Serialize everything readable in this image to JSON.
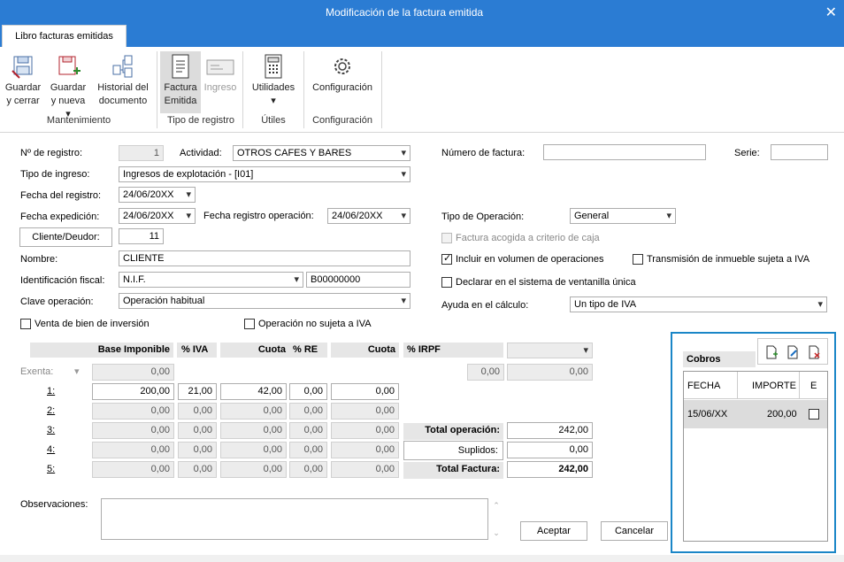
{
  "window": {
    "title": "Modificación de la factura emitida",
    "close": "✕"
  },
  "tab": {
    "label": "Libro facturas emitidas"
  },
  "ribbon": {
    "guardar_cerrar": [
      "Guardar",
      "y cerrar"
    ],
    "guardar_nueva": [
      "Guardar",
      "y nueva ▾"
    ],
    "historial": [
      "Historial del",
      "documento"
    ],
    "factura_emitida": [
      "Factura",
      "Emitida"
    ],
    "ingreso": "Ingreso",
    "utilidades": "Utilidades",
    "configuracion": "Configuración",
    "groups": {
      "mantenimiento": "Mantenimiento",
      "tipo": "Tipo de registro",
      "utiles": "Útiles",
      "config": "Configuración"
    }
  },
  "form": {
    "n_registro": {
      "label": "Nº de registro:",
      "value": "1"
    },
    "actividad": {
      "label": "Actividad:",
      "value": "OTROS CAFES Y BARES"
    },
    "numero_factura": {
      "label": "Número de factura:",
      "value": ""
    },
    "serie": {
      "label": "Serie:",
      "value": ""
    },
    "tipo_ingreso": {
      "label": "Tipo de ingreso:",
      "value": "Ingresos de explotación - [I01]"
    },
    "fecha_registro": {
      "label": "Fecha del registro:",
      "value": "24/06/20XX"
    },
    "fecha_expedicion": {
      "label": "Fecha expedición:",
      "value": "24/06/20XX"
    },
    "fecha_reg_op": {
      "label": "Fecha registro operación:",
      "value": "24/06/20XX"
    },
    "tipo_operacion": {
      "label": "Tipo de Operación:",
      "value": "General"
    },
    "cliente_btn": "Cliente/Deudor:",
    "cliente_val": "11",
    "factura_caja": "Factura acogida a criterio de caja",
    "nombre": {
      "label": "Nombre:",
      "value": "CLIENTE"
    },
    "incluir_vol": "Incluir en  volumen de operaciones",
    "transmision": "Transmisión de inmueble sujeta a IVA",
    "ident_fiscal": {
      "label": "Identificación fiscal:",
      "type": "N.I.F.",
      "value": "B00000000"
    },
    "declarar": "Declarar en el sistema de ventanilla única",
    "clave_op": {
      "label": "Clave operación:",
      "value": "Operación habitual"
    },
    "ayuda": {
      "label": "Ayuda en el cálculo:",
      "value": "Un tipo de IVA"
    },
    "venta_inversion": "Venta de bien de inversión",
    "op_no_sujeta": "Operación no sujeta a IVA",
    "observaciones": "Observaciones:"
  },
  "grid": {
    "headers": {
      "base": "Base Imponible",
      "iva": "% IVA",
      "cuota": "Cuota",
      "re": "% RE",
      "cuota2": "Cuota",
      "irpf": "% IRPF"
    },
    "exenta_label": "Exenta:",
    "exenta": {
      "base": "0,00",
      "irpf1": "0,00",
      "irpf2": "0,00"
    },
    "rows": [
      {
        "n": "1:",
        "base": "200,00",
        "iva": "21,00",
        "cuota": "42,00",
        "re": "0,00",
        "cuota2": "0,00"
      },
      {
        "n": "2:",
        "base": "0,00",
        "iva": "0,00",
        "cuota": "0,00",
        "re": "0,00",
        "cuota2": "0,00"
      },
      {
        "n": "3:",
        "base": "0,00",
        "iva": "0,00",
        "cuota": "0,00",
        "re": "0,00",
        "cuota2": "0,00"
      },
      {
        "n": "4:",
        "base": "0,00",
        "iva": "0,00",
        "cuota": "0,00",
        "re": "0,00",
        "cuota2": "0,00"
      },
      {
        "n": "5:",
        "base": "0,00",
        "iva": "0,00",
        "cuota": "0,00",
        "re": "0,00",
        "cuota2": "0,00"
      }
    ],
    "total_operacion": {
      "label": "Total operación:",
      "value": "242,00"
    },
    "suplidos": {
      "label": "Suplidos:",
      "value": "0,00"
    },
    "total_factura": {
      "label": "Total Factura:",
      "value": "242,00"
    }
  },
  "cobros": {
    "title": "Cobros",
    "cols": [
      "FECHA",
      "IMPORTE",
      "E"
    ],
    "row": {
      "fecha": "15/06/XX",
      "importe": "200,00"
    }
  },
  "buttons": {
    "aceptar": "Aceptar",
    "cancelar": "Cancelar"
  }
}
